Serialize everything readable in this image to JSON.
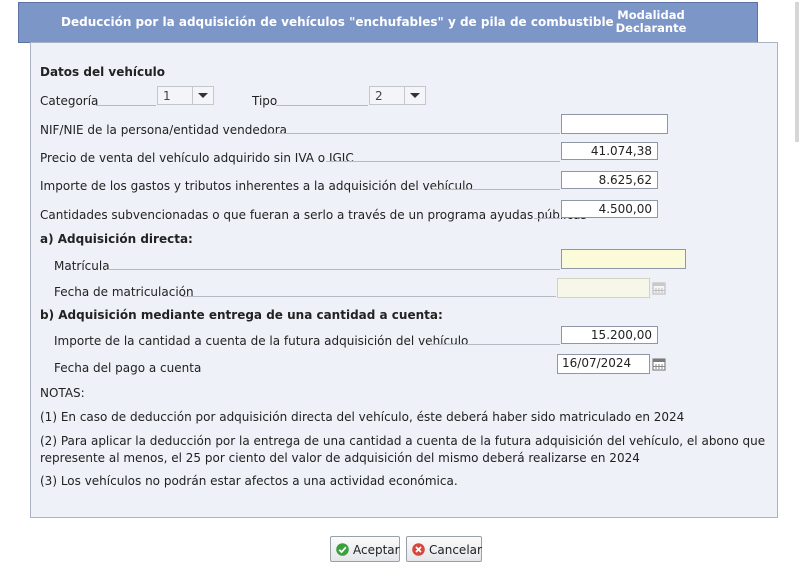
{
  "header": {
    "title": "Deducción por la adquisición de vehículos \"enchufables\" y de pila de combustible",
    "mode_line1": "Modalidad",
    "mode_line2": "Declarante"
  },
  "vehicle": {
    "section_title": "Datos del vehículo",
    "categoria_label": "Categoría",
    "categoria_value": "1",
    "tipo_label": "Tipo",
    "tipo_value": "2",
    "nif_label": "NIF/NIE de la persona/entidad vendedora",
    "nif_value": "",
    "precio_label": "Precio de venta del vehículo adquirido sin IVA o IGIC",
    "precio_value": "41.074,38",
    "gastos_label": "Importe de los gastos y tributos inherentes a la adquisición del vehículo",
    "gastos_value": "8.625,62",
    "subv_label": "Cantidades subvencionadas o que fueran a serlo a través de un programa ayudas públicas",
    "subv_value": "4.500,00"
  },
  "direct": {
    "section_title": "a) Adquisición directa:",
    "matricula_label": "Matrícula",
    "matricula_value": "",
    "fecha_label": "Fecha de matriculación",
    "fecha_value": ""
  },
  "advance": {
    "section_title": "b) Adquisición mediante entrega de una cantidad a cuenta:",
    "importe_label": "Importe de la cantidad a cuenta de la futura adquisición del vehículo",
    "importe_value": "15.200,00",
    "fecha_label": "Fecha del pago a cuenta",
    "fecha_value": "16/07/2024"
  },
  "notes": {
    "title": "NOTAS:",
    "n1": "(1) En caso de deducción por adquisición directa del vehículo, éste deberá haber sido matriculado en 2024",
    "n2_line1": "(2) Para aplicar la deducción por la entrega de una cantidad a cuenta de la futura adquisición del vehículo, el abono que",
    "n2_line2": "represente al menos, el 25 por ciento del valor de adquisición del mismo deberá realizarse en 2024",
    "n3": "(3) Los vehículos no podrán estar afectos a una actividad económica."
  },
  "buttons": {
    "accept": "Aceptar",
    "cancel": "Cancelar"
  },
  "icons": {
    "accept": "check-icon",
    "cancel": "close-icon",
    "calendar": "calendar-icon"
  },
  "colors": {
    "header_bg": "#7d96c8",
    "panel_bg": "#eef1f7",
    "highlight_input": "#fcfbd9",
    "accept_icon": "#3aa03a",
    "cancel_icon": "#d9473c"
  }
}
